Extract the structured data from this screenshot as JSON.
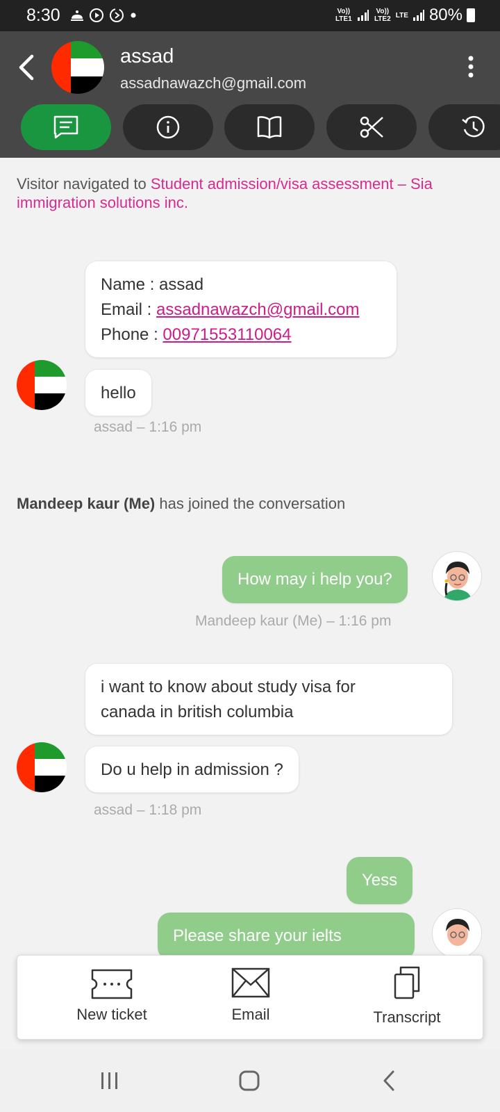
{
  "status_bar": {
    "time": "8:30",
    "sim1": "Vo)) LTE1",
    "sim2": "Vo)) LTE2",
    "lte": "LTE",
    "battery": "80%"
  },
  "header": {
    "name": "assad",
    "email": "assadnawazch@gmail.com",
    "tabs": [
      {
        "icon": "chat-icon",
        "active": true
      },
      {
        "icon": "info-icon",
        "active": false
      },
      {
        "icon": "book-icon",
        "active": false
      },
      {
        "icon": "scissors-icon",
        "active": false
      },
      {
        "icon": "history-icon",
        "active": false
      }
    ]
  },
  "chat": {
    "navigation": {
      "prefix": "Visitor navigated to ",
      "link": "Student admission/visa assessment – Sia immigration solutions inc."
    },
    "info_card": {
      "name_label": "Name : ",
      "name": "assad",
      "email_label": "Email : ",
      "email": "assadnawazch@gmail.com",
      "phone_label": "Phone : ",
      "phone": "00971553110064"
    },
    "msg_hello": "hello",
    "stamp1": "assad – 1:16 pm",
    "joined_name": "Mandeep kaur (Me)",
    "joined_text": " has joined the conversation",
    "msg_help": "How may i help you?",
    "stamp2": "Mandeep kaur (Me) – 1:16 pm",
    "msg_study_line1": "i want to know about study visa for",
    "msg_study_line2": "canada in british columbia",
    "msg_admission": "Do u help in admission ?",
    "stamp3": "assad – 1:18 pm",
    "msg_yess": "Yess",
    "msg_partial": "Please share your ielts"
  },
  "actions": {
    "new_ticket": "New ticket",
    "email": "Email",
    "transcript": "Transcript"
  },
  "colors": {
    "active_tab": "#1a9640",
    "agent_bubble": "#90cd8b",
    "link": "#d62b8f",
    "header": "#474747"
  }
}
